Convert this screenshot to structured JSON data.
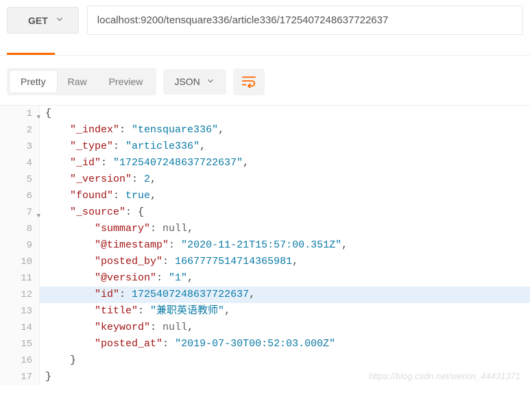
{
  "request": {
    "method": "GET",
    "url": "localhost:9200/tensquare336/article336/1725407248637722637"
  },
  "view": {
    "tabs": {
      "pretty": "Pretty",
      "raw": "Raw",
      "preview": "Preview"
    },
    "format": "JSON"
  },
  "code": {
    "lines": [
      {
        "n": "1",
        "fold": true,
        "indent": 0,
        "tokens": [
          {
            "t": "p",
            "v": "{"
          }
        ]
      },
      {
        "n": "2",
        "indent": 1,
        "tokens": [
          {
            "t": "key",
            "v": "\"_index\""
          },
          {
            "t": "p",
            "v": ": "
          },
          {
            "t": "str",
            "v": "\"tensquare336\""
          },
          {
            "t": "p",
            "v": ","
          }
        ]
      },
      {
        "n": "3",
        "indent": 1,
        "tokens": [
          {
            "t": "key",
            "v": "\"_type\""
          },
          {
            "t": "p",
            "v": ": "
          },
          {
            "t": "str",
            "v": "\"article336\""
          },
          {
            "t": "p",
            "v": ","
          }
        ]
      },
      {
        "n": "4",
        "indent": 1,
        "tokens": [
          {
            "t": "key",
            "v": "\"_id\""
          },
          {
            "t": "p",
            "v": ": "
          },
          {
            "t": "str",
            "v": "\"1725407248637722637\""
          },
          {
            "t": "p",
            "v": ","
          }
        ]
      },
      {
        "n": "5",
        "indent": 1,
        "tokens": [
          {
            "t": "key",
            "v": "\"_version\""
          },
          {
            "t": "p",
            "v": ": "
          },
          {
            "t": "num",
            "v": "2"
          },
          {
            "t": "p",
            "v": ","
          }
        ]
      },
      {
        "n": "6",
        "indent": 1,
        "tokens": [
          {
            "t": "key",
            "v": "\"found\""
          },
          {
            "t": "p",
            "v": ": "
          },
          {
            "t": "kw",
            "v": "true"
          },
          {
            "t": "p",
            "v": ","
          }
        ]
      },
      {
        "n": "7",
        "fold": true,
        "indent": 1,
        "tokens": [
          {
            "t": "key",
            "v": "\"_source\""
          },
          {
            "t": "p",
            "v": ": {"
          }
        ]
      },
      {
        "n": "8",
        "indent": 2,
        "tokens": [
          {
            "t": "key",
            "v": "\"summary\""
          },
          {
            "t": "p",
            "v": ": "
          },
          {
            "t": "nul",
            "v": "null"
          },
          {
            "t": "p",
            "v": ","
          }
        ]
      },
      {
        "n": "9",
        "indent": 2,
        "tokens": [
          {
            "t": "key",
            "v": "\"@timestamp\""
          },
          {
            "t": "p",
            "v": ": "
          },
          {
            "t": "str",
            "v": "\"2020-11-21T15:57:00.351Z\""
          },
          {
            "t": "p",
            "v": ","
          }
        ]
      },
      {
        "n": "10",
        "indent": 2,
        "tokens": [
          {
            "t": "key",
            "v": "\"posted_by\""
          },
          {
            "t": "p",
            "v": ": "
          },
          {
            "t": "num",
            "v": "1667777514714365981"
          },
          {
            "t": "p",
            "v": ","
          }
        ]
      },
      {
        "n": "11",
        "indent": 2,
        "tokens": [
          {
            "t": "key",
            "v": "\"@version\""
          },
          {
            "t": "p",
            "v": ": "
          },
          {
            "t": "str",
            "v": "\"1\""
          },
          {
            "t": "p",
            "v": ","
          }
        ]
      },
      {
        "n": "12",
        "hl": true,
        "indent": 2,
        "tokens": [
          {
            "t": "key",
            "v": "\"id\""
          },
          {
            "t": "p",
            "v": ": "
          },
          {
            "t": "num",
            "v": "1725407248637722637"
          },
          {
            "t": "p",
            "v": ","
          }
        ]
      },
      {
        "n": "13",
        "indent": 2,
        "tokens": [
          {
            "t": "key",
            "v": "\"title\""
          },
          {
            "t": "p",
            "v": ": "
          },
          {
            "t": "str",
            "v": "\"兼职英语教师\""
          },
          {
            "t": "p",
            "v": ","
          }
        ]
      },
      {
        "n": "14",
        "indent": 2,
        "tokens": [
          {
            "t": "key",
            "v": "\"keyword\""
          },
          {
            "t": "p",
            "v": ": "
          },
          {
            "t": "nul",
            "v": "null"
          },
          {
            "t": "p",
            "v": ","
          }
        ]
      },
      {
        "n": "15",
        "indent": 2,
        "tokens": [
          {
            "t": "key",
            "v": "\"posted_at\""
          },
          {
            "t": "p",
            "v": ": "
          },
          {
            "t": "str",
            "v": "\"2019-07-30T00:52:03.000Z\""
          }
        ]
      },
      {
        "n": "16",
        "indent": 1,
        "tokens": [
          {
            "t": "p",
            "v": "}"
          }
        ]
      },
      {
        "n": "17",
        "indent": 0,
        "tokens": [
          {
            "t": "p",
            "v": "}"
          }
        ]
      }
    ]
  },
  "watermark": "https://blog.csdn.net/weixin_44431371"
}
